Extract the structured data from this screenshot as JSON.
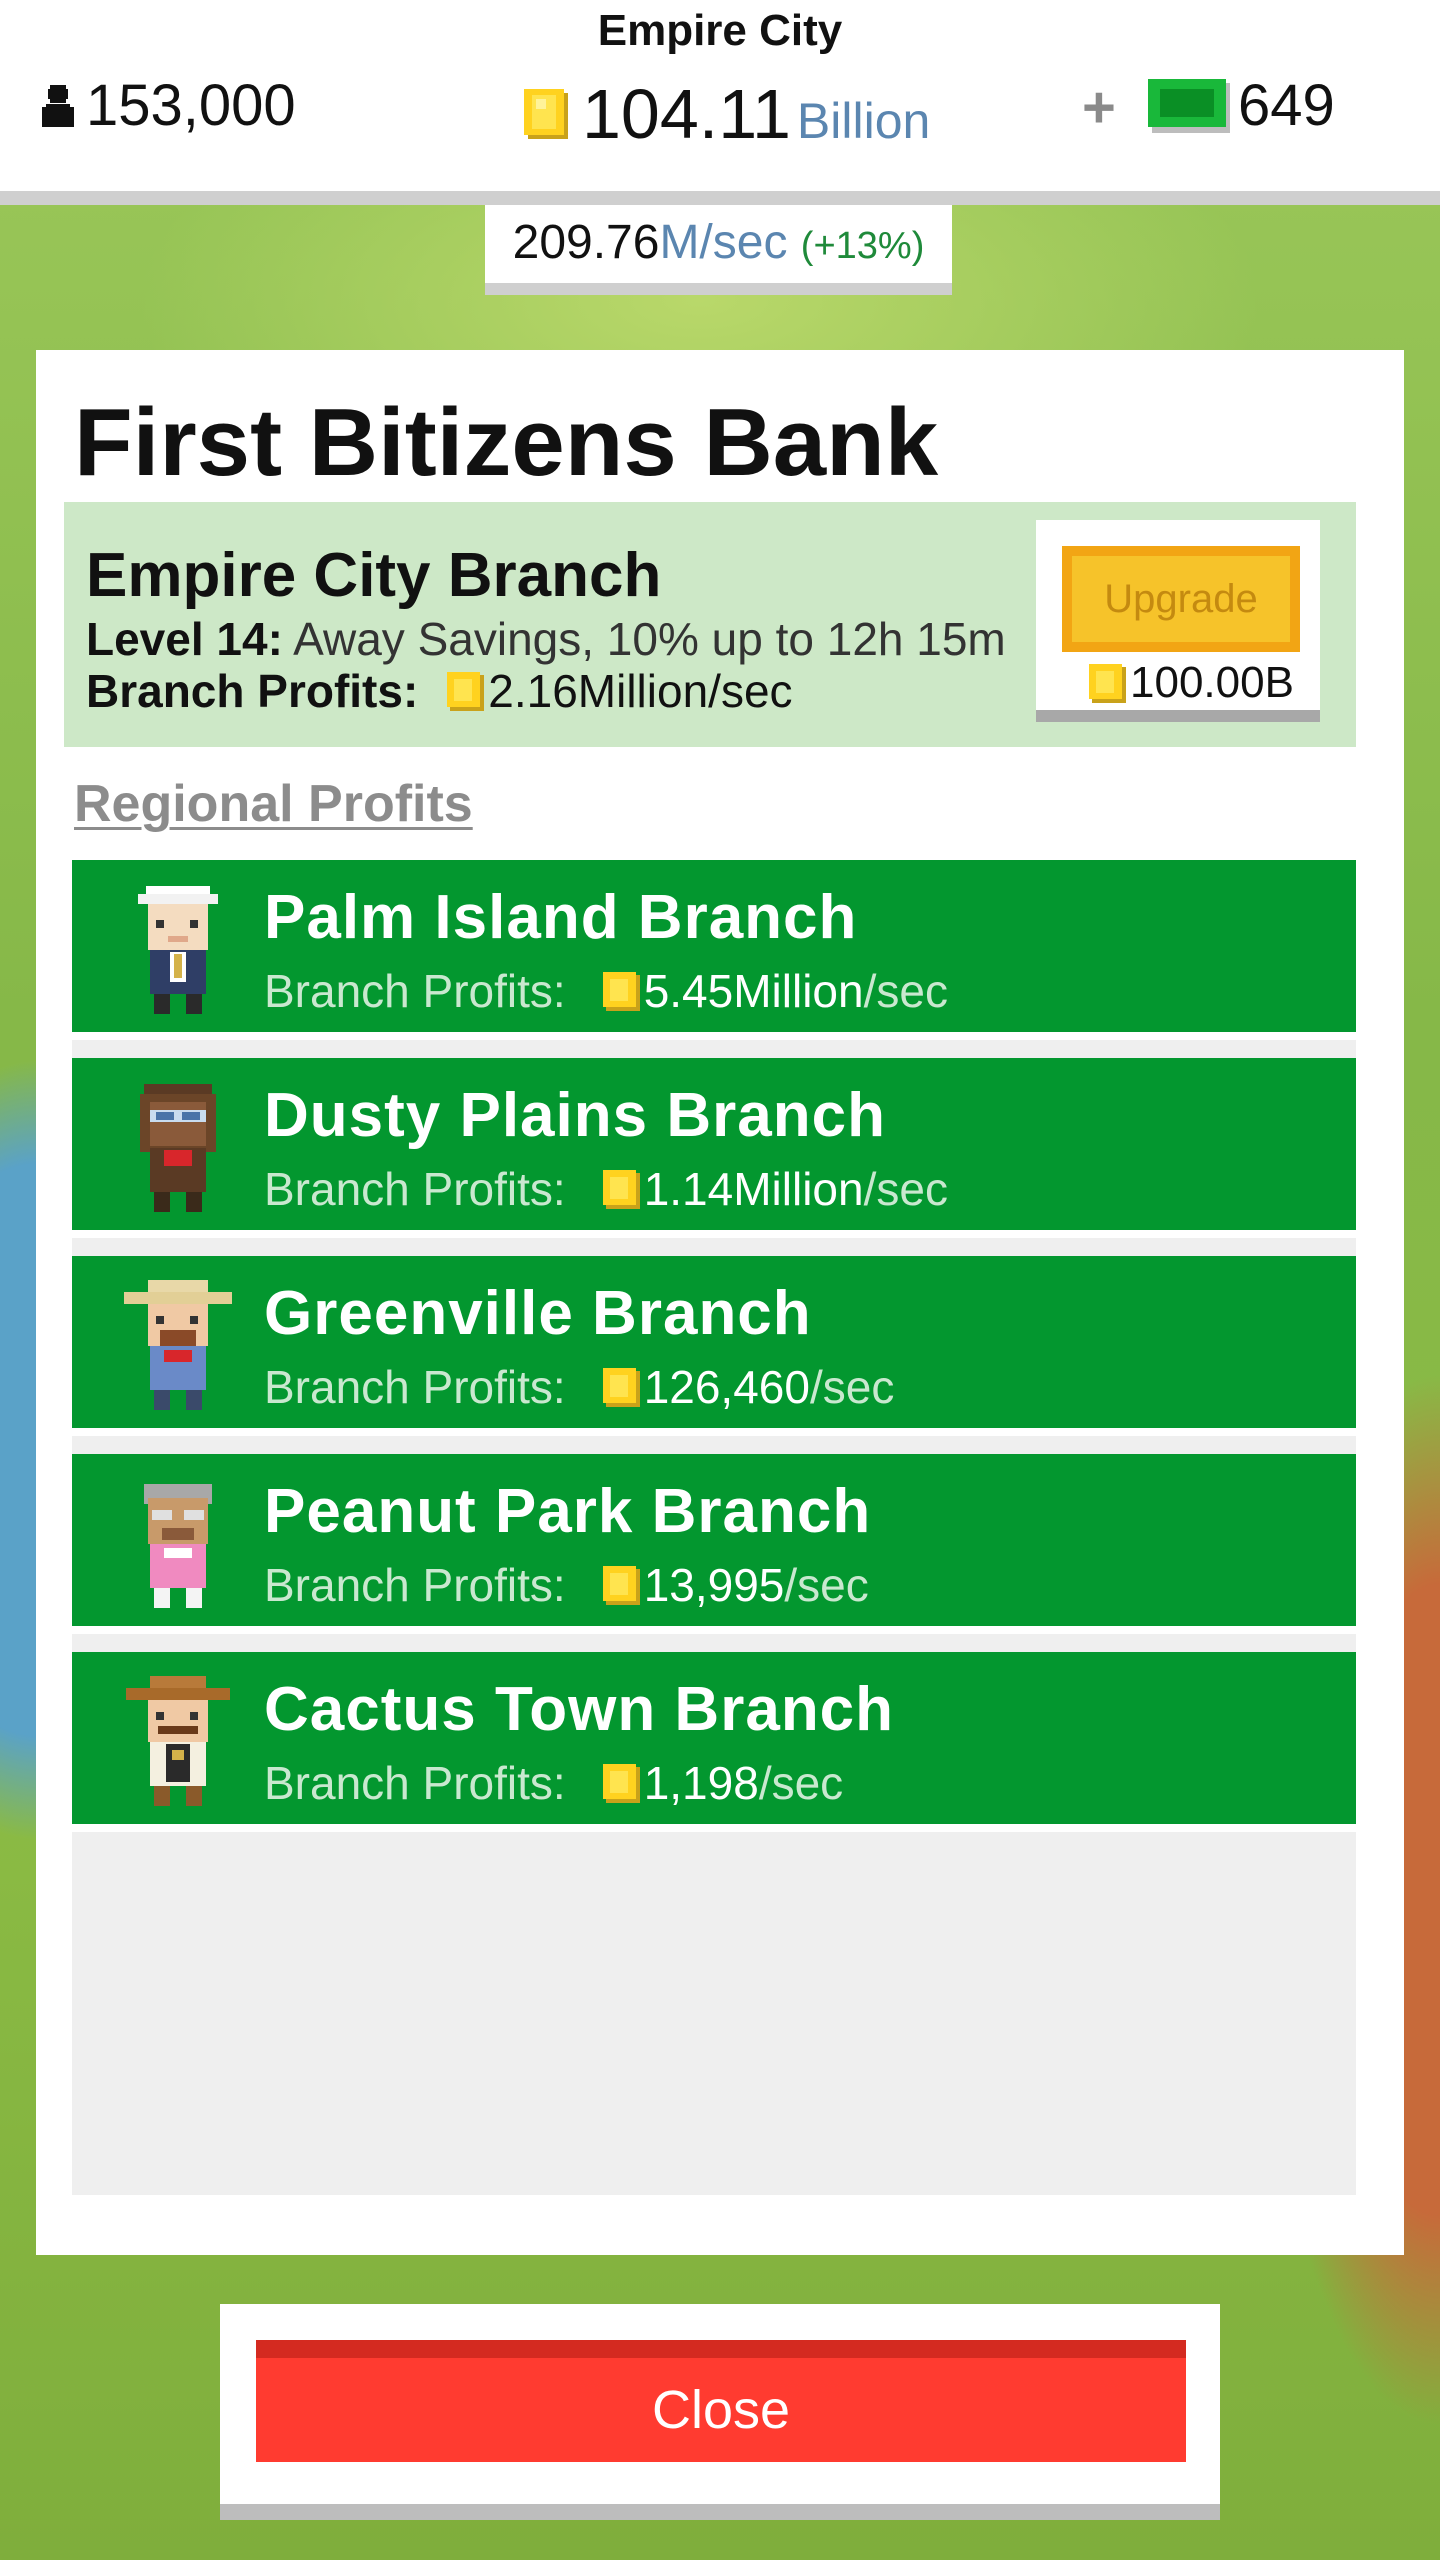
{
  "header": {
    "city_name": "Empire City",
    "population": "153,000",
    "cash_amount": "104.11",
    "cash_unit": "Billion",
    "plus_label": "+",
    "bux_amount": "649"
  },
  "income_rate": {
    "value": "209.76",
    "unit": "M/sec",
    "bonus": "(+13%)"
  },
  "bank": {
    "title": "First Bitizens Bank",
    "home_branch": {
      "name": "Empire City Branch",
      "level_label": "Level 14:",
      "level_desc": "Away Savings, 10% up to 12h 15m",
      "profits_label": "Branch Profits:",
      "profits_value": "2.16Million/sec"
    },
    "upgrade": {
      "label": "Upgrade",
      "cost": "100.00B"
    },
    "regional_label": "Regional Profits",
    "regional_branches": [
      {
        "name": "Palm Island Branch",
        "profits_label": "Branch Profits:",
        "value": "5.45Million",
        "per": "/sec"
      },
      {
        "name": "Dusty Plains Branch",
        "profits_label": "Branch Profits:",
        "value": "1.14Million",
        "per": "/sec"
      },
      {
        "name": "Greenville Branch",
        "profits_label": "Branch Profits:",
        "value": "126,460",
        "per": "/sec"
      },
      {
        "name": "Peanut Park Branch",
        "profits_label": "Branch Profits:",
        "value": "13,995",
        "per": "/sec"
      },
      {
        "name": "Cactus Town Branch",
        "profits_label": "Branch Profits:",
        "value": "1,198",
        "per": "/sec"
      }
    ]
  },
  "close_label": "Close",
  "colors": {
    "row_green": "#03972f",
    "home_branch_bg": "#cde8c7",
    "upgrade_yellow": "#f6c32a",
    "close_red": "#ff3b30",
    "unit_blue": "#5b86b0"
  },
  "icons": {
    "population": "person-icon",
    "cash": "coin-icon",
    "premium": "bux-icon"
  }
}
